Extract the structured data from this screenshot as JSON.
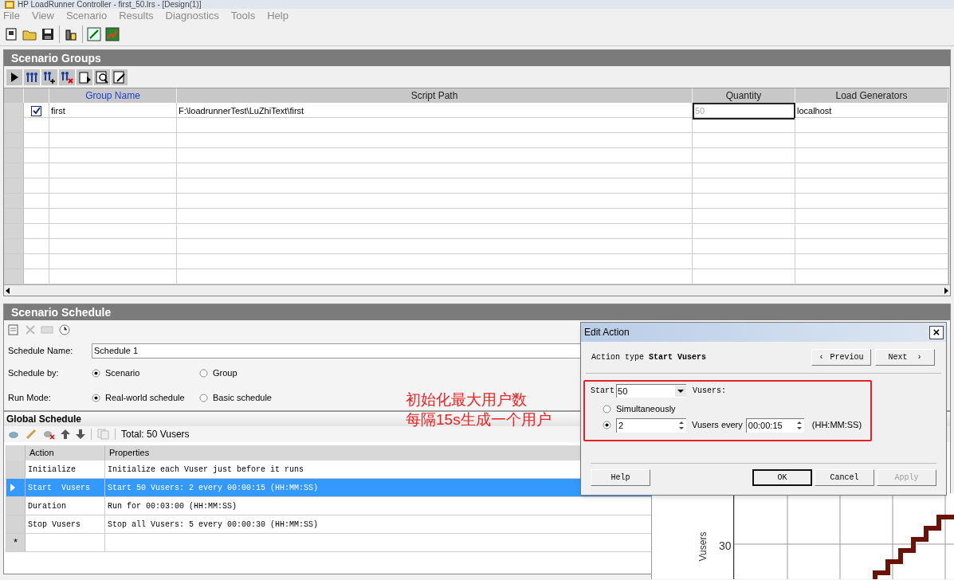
{
  "window": {
    "title": "HP LoadRunner Controller - first_50.lrs - [Design(1)]"
  },
  "menu": [
    "File",
    "View",
    "Scenario",
    "Results",
    "Diagnostics",
    "Tools",
    "Help"
  ],
  "scenario_groups": {
    "title": "Scenario Groups",
    "columns": [
      "Group Name",
      "Script Path",
      "Quantity",
      "Load Generators"
    ],
    "rows": [
      {
        "checked": true,
        "group_name": "first",
        "script_path": "F:\\loadrunnerTest\\LuZhiText\\first",
        "quantity": "50",
        "load_generators": "localhost"
      }
    ]
  },
  "scenario_schedule": {
    "title": "Scenario Schedule",
    "schedule_name_label": "Schedule Name:",
    "schedule_name": "Schedule 1",
    "schedule_by_label": "Schedule by:",
    "schedule_by": [
      {
        "label": "Scenario",
        "selected": true
      },
      {
        "label": "Group",
        "selected": false
      }
    ],
    "run_mode_label": "Run Mode:",
    "run_mode": [
      {
        "label": "Real-world schedule",
        "selected": true
      },
      {
        "label": "Basic schedule",
        "selected": false
      }
    ]
  },
  "global_schedule": {
    "title": "Global Schedule",
    "total": "Total: 50 Vusers",
    "columns": [
      "Action",
      "Properties"
    ],
    "rows": [
      {
        "action": "Initialize",
        "properties": "Initialize each Vuser just before it runs",
        "selected": false
      },
      {
        "action": "Start  Vusers",
        "properties": "Start 50 Vusers: 2 every 00:00:15 (HH:MM:SS)",
        "selected": true
      },
      {
        "action": "Duration",
        "properties": "Run for 00:03:00 (HH:MM:SS)",
        "selected": false
      },
      {
        "action": "Stop Vusers",
        "properties": "Stop all Vusers: 5 every 00:00:30 (HH:MM:SS)",
        "selected": false
      }
    ],
    "new_row_marker": "*"
  },
  "chart": {
    "ylabel": "Vusers",
    "tick": "30"
  },
  "annotation": [
    "初始化最大用户数",
    "每隔15s生成一个用户"
  ],
  "edit_action": {
    "title": "Edit Action",
    "close": "×",
    "action_type": "Action type **Start Vusers**",
    "previous_arrow": "‹",
    "previous": "Previou",
    "next": "Next",
    "next_arrow": "›",
    "start_label": "Start",
    "start_value": "50",
    "vusers_label": "Vusers:",
    "modes": [
      {
        "kind": "plain",
        "label": "Simultaneously",
        "selected": false
      },
      {
        "kind": "interval",
        "count": "2",
        "every_label": "Vusers every",
        "time": "00:00:15",
        "format": "(HH:MM:SS)",
        "selected": true
      }
    ],
    "buttons": [
      {
        "label": "Help",
        "disabled": false,
        "default": false
      },
      {
        "label": "OK",
        "disabled": false,
        "default": true
      },
      {
        "label": "Cancel",
        "disabled": false,
        "default": false
      },
      {
        "label": "Apply",
        "disabled": true,
        "default": false
      }
    ]
  }
}
